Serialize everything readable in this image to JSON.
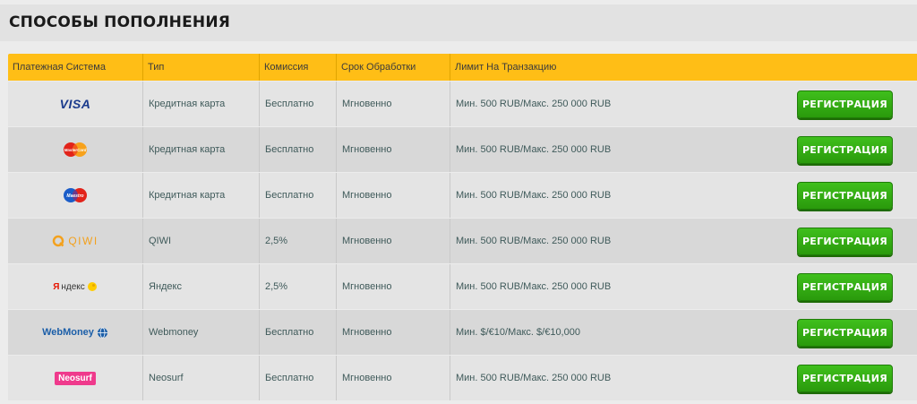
{
  "header": {
    "title": "СПОСОБЫ ПОПОЛНЕНИЯ"
  },
  "table": {
    "columns": [
      "Платежная Система",
      "Тип",
      "Комиссия",
      "Срок Обработки",
      "Лимит На Транзакцию"
    ],
    "rows": [
      {
        "logo": "VISA",
        "logo_icon": "visa-logo-icon",
        "type": "Кредитная карта",
        "fee": "Бесплатно",
        "time": "Мгновенно",
        "limit": "Мин. 500 RUB/Макс. 250 000 RUB",
        "button": "РЕГИСТРАЦИЯ"
      },
      {
        "logo": "MasterCard",
        "logo_icon": "mastercard-logo-icon",
        "type": "Кредитная карта",
        "fee": "Бесплатно",
        "time": "Мгновенно",
        "limit": "Мин. 500 RUB/Макс. 250 000 RUB",
        "button": "РЕГИСТРАЦИЯ"
      },
      {
        "logo": "Maestro",
        "logo_icon": "maestro-logo-icon",
        "type": "Кредитная карта",
        "fee": "Бесплатно",
        "time": "Мгновенно",
        "limit": "Мин. 500 RUB/Макс. 250 000 RUB",
        "button": "РЕГИСТРАЦИЯ"
      },
      {
        "logo": "QIWI",
        "logo_icon": "qiwi-logo-icon",
        "type": "QIWI",
        "fee": "2,5%",
        "time": "Мгновенно",
        "limit": "Мин. 500 RUB/Макс. 250 000 RUB",
        "button": "РЕГИСТРАЦИЯ"
      },
      {
        "logo": "Яндекс",
        "logo_icon": "yandex-logo-icon",
        "type": "Яндекс",
        "fee": "2,5%",
        "time": "Мгновенно",
        "limit": "Мин. 500 RUB/Макс. 250 000 RUB",
        "button": "РЕГИСТРАЦИЯ"
      },
      {
        "logo": "WebMoney",
        "logo_icon": "webmoney-logo-icon",
        "type": "Webmoney",
        "fee": "Бесплатно",
        "time": "Мгновенно",
        "limit": "Мин. $/€10/Макс. $/€10,000",
        "button": "РЕГИСТРАЦИЯ"
      },
      {
        "logo": "Neosurf",
        "logo_icon": "neosurf-logo-icon",
        "type": "Neosurf",
        "fee": "Бесплатно",
        "time": "Мгновенно",
        "limit": "Мин. 500 RUB/Макс. 250 000 RUB",
        "button": "РЕГИСТРАЦИЯ"
      }
    ]
  },
  "colors": {
    "header_bar": "#ffbe16",
    "button": "#2fa812",
    "row_light": "#e4e4e4",
    "row_dark": "#d8d8d8"
  }
}
